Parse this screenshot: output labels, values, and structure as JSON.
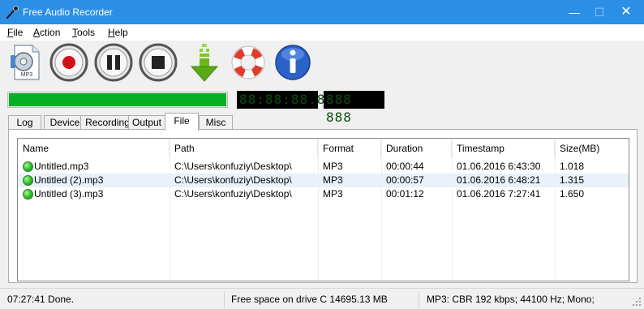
{
  "window": {
    "title": "Free Audio Recorder",
    "minimize_glyph": "—",
    "maximize_glyph": "☐",
    "close_glyph": "✕"
  },
  "menu": {
    "items": [
      "File",
      "Action",
      "Tools",
      "Help"
    ]
  },
  "toolbar": {
    "icons": [
      "mp3-settings-icon",
      "record-icon",
      "pause-icon",
      "stop-icon",
      "download-arrow-icon",
      "lifebuoy-help-icon",
      "info-icon"
    ],
    "mp3_label": "MP3",
    "colors": {
      "record": "#d4101a",
      "download": "#7cc822",
      "lifebuoy_red": "#e23b2a",
      "info_blue": "#2a62c8"
    }
  },
  "progress": {
    "level": 1.0,
    "color": "#06b025",
    "timer_display": "88:88:88.88",
    "extra_display": "888 888"
  },
  "tabs": {
    "items": [
      "Log",
      "Device",
      "Recording",
      "Output",
      "File",
      "Misc"
    ],
    "active": "File"
  },
  "file_list": {
    "columns": [
      "Name",
      "Path",
      "Format",
      "Duration",
      "Timestamp",
      "Size(MB)"
    ],
    "rows": [
      {
        "name": "Untitled.mp3",
        "path": "C:\\Users\\konfuziy\\Desktop\\",
        "format": "MP3",
        "duration": "00:00:44",
        "timestamp": "01.06.2016 6:43:30",
        "size": "1.018"
      },
      {
        "name": "Untitled (2).mp3",
        "path": "C:\\Users\\konfuziy\\Desktop\\",
        "format": "MP3",
        "duration": "00:00:57",
        "timestamp": "01.06.2016 6:48:21",
        "size": "1.315"
      },
      {
        "name": "Untitled (3).mp3",
        "path": "C:\\Users\\konfuziy\\Desktop\\",
        "format": "MP3",
        "duration": "00:01:12",
        "timestamp": "01.06.2016 7:27:41",
        "size": "1.650"
      }
    ]
  },
  "status": {
    "log": "07:27:41  Done.",
    "free_space": "Free space on drive C  14695.13 MB",
    "format_info": "MP3:  CBR 192 kbps; 44100 Hz; Mono;"
  }
}
